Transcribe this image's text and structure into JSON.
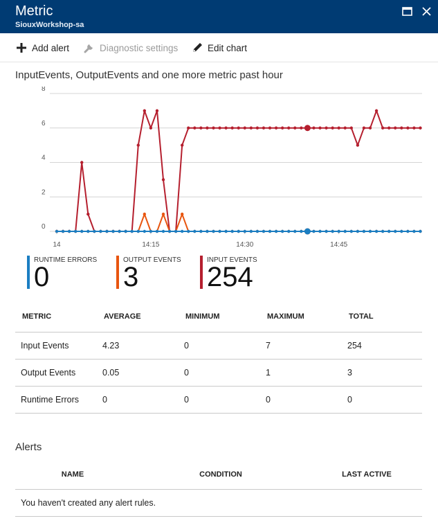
{
  "window": {
    "title": "Metric",
    "subtitle": "SiouxWorkshop-sa"
  },
  "toolbar": {
    "add_alert": "Add alert",
    "diagnostic_settings": "Diagnostic settings",
    "edit_chart": "Edit chart"
  },
  "chart_title": "InputEvents, OutputEvents and one more metric past hour",
  "colors": {
    "titlebar": "#003b73",
    "input_events": "#b51f2e",
    "output_events": "#e8550f",
    "runtime_errors": "#1b7ec2"
  },
  "chart_data": {
    "type": "line",
    "y_ticks": [
      "8",
      "6",
      "4",
      "2",
      "0"
    ],
    "ylim": [
      0,
      8
    ],
    "x_ticks": [
      {
        "label": "14",
        "x": 0
      },
      {
        "label": "14:15",
        "x": 15
      },
      {
        "label": "14:30",
        "x": 30
      },
      {
        "label": "14:45",
        "x": 45
      }
    ],
    "xlim": [
      -1,
      57
    ],
    "grid": true,
    "series": [
      {
        "key": "input",
        "color": "#b51f2e",
        "values": [
          0,
          0,
          0,
          0,
          4,
          1,
          0,
          0,
          0,
          0,
          0,
          0,
          0,
          5,
          7,
          6,
          7,
          3,
          0,
          0,
          5,
          6,
          6,
          6,
          6,
          6,
          6,
          6,
          6,
          6,
          6,
          6,
          6,
          6,
          6,
          6,
          6,
          6,
          6,
          6,
          6,
          6,
          6,
          6,
          6,
          6,
          6,
          6,
          5,
          6,
          6,
          7,
          6,
          6,
          6,
          6,
          6,
          6,
          6
        ]
      },
      {
        "key": "output",
        "color": "#e8550f",
        "values": [
          0,
          0,
          0,
          0,
          0,
          0,
          0,
          0,
          0,
          0,
          0,
          0,
          0,
          0,
          1,
          0,
          0,
          1,
          0,
          0,
          1,
          0,
          0,
          0,
          0,
          0,
          0,
          0,
          0,
          0,
          0,
          0,
          0,
          0,
          0,
          0,
          0,
          0,
          0,
          0,
          0,
          0,
          0,
          0,
          0,
          0,
          0,
          0,
          0,
          0,
          0,
          0,
          0,
          0,
          0,
          0,
          0,
          0,
          0
        ]
      },
      {
        "key": "runtime",
        "color": "#1b7ec2",
        "values": [
          0,
          0,
          0,
          0,
          0,
          0,
          0,
          0,
          0,
          0,
          0,
          0,
          0,
          0,
          0,
          0,
          0,
          0,
          0,
          0,
          0,
          0,
          0,
          0,
          0,
          0,
          0,
          0,
          0,
          0,
          0,
          0,
          0,
          0,
          0,
          0,
          0,
          0,
          0,
          0,
          0,
          0,
          0,
          0,
          0,
          0,
          0,
          0,
          0,
          0,
          0,
          0,
          0,
          0,
          0,
          0,
          0,
          0,
          0
        ]
      }
    ],
    "highlight_index": 40
  },
  "legend": {
    "runtime_errors": {
      "label": "RUNTIME ERRORS",
      "value": "0"
    },
    "output_events": {
      "label": "OUTPUT EVENTS",
      "value": "3"
    },
    "input_events": {
      "label": "INPUT EVENTS",
      "value": "254"
    }
  },
  "metrics_table": {
    "headers": [
      "METRIC",
      "AVERAGE",
      "MINIMUM",
      "MAXIMUM",
      "TOTAL"
    ],
    "rows": [
      [
        "Input Events",
        "4.23",
        "0",
        "7",
        "254"
      ],
      [
        "Output Events",
        "0.05",
        "0",
        "1",
        "3"
      ],
      [
        "Runtime Errors",
        "0",
        "0",
        "0",
        "0"
      ]
    ]
  },
  "alerts": {
    "heading": "Alerts",
    "headers": [
      "NAME",
      "CONDITION",
      "LAST ACTIVE"
    ],
    "empty_message": "You haven't created any alert rules."
  }
}
